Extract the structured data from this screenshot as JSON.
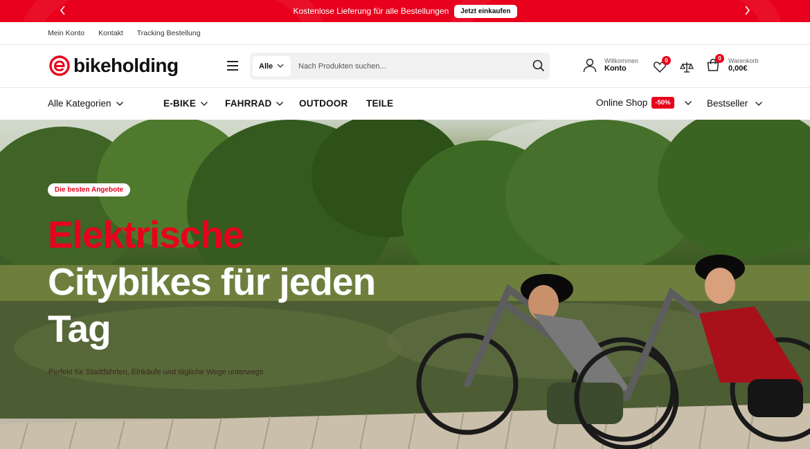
{
  "promo": {
    "text": "Kostenlose Lieferung für alle Bestellungen",
    "button": "Jetzt einkaufen",
    "color": "#e8001c"
  },
  "utility_nav": [
    "Mein Konto",
    "Kontakt",
    "Tracking Bestellung"
  ],
  "header": {
    "logo_text": "bikeholding",
    "search": {
      "category": "Alle",
      "placeholder": "Nach Produkten suchen..."
    },
    "account": {
      "greeting": "Willkommen",
      "label": "Konto"
    },
    "wishlist_count": "0",
    "cart": {
      "count": "0",
      "label": "Warenkorb",
      "total": "0,00€"
    }
  },
  "category_nav": {
    "all_categories": "Alle Kategorien",
    "items": [
      "E-BIKE",
      "FAHRRAD",
      "OUTDOOR",
      "TEILE"
    ],
    "online_shop": "Online Shop",
    "sale_badge": "-50%",
    "bestseller": "Bestseller"
  },
  "hero": {
    "tag": "Die besten Angebote",
    "title_red": "Elektrische",
    "title_white_1": "Citybikes für jeden",
    "title_white_2": "Tag",
    "subtitle": "Perfekt für Stadtfahrten, Einkäufe und tägliche Wege unterwegs"
  }
}
